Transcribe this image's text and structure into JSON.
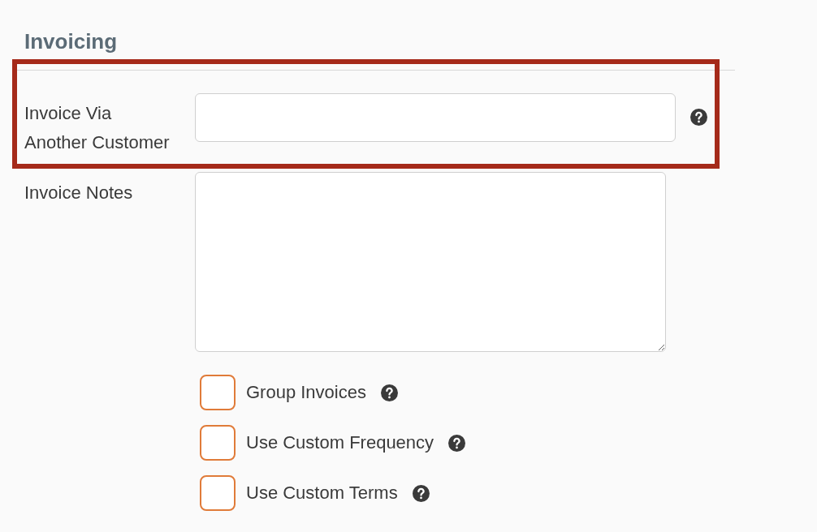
{
  "section": {
    "title": "Invoicing"
  },
  "fields": [
    {
      "kind": "input",
      "label": "Invoice Via Another Customer",
      "help": true,
      "highlighted": true
    },
    {
      "kind": "textarea",
      "label": "Invoice Notes",
      "help": false,
      "highlighted": false
    }
  ],
  "checkboxes": [
    {
      "label": "Group Invoices",
      "checked": false,
      "help": true
    },
    {
      "label": "Use Custom Frequency",
      "checked": false,
      "help": true
    },
    {
      "label": "Use Custom Terms",
      "checked": false,
      "help": true
    }
  ]
}
